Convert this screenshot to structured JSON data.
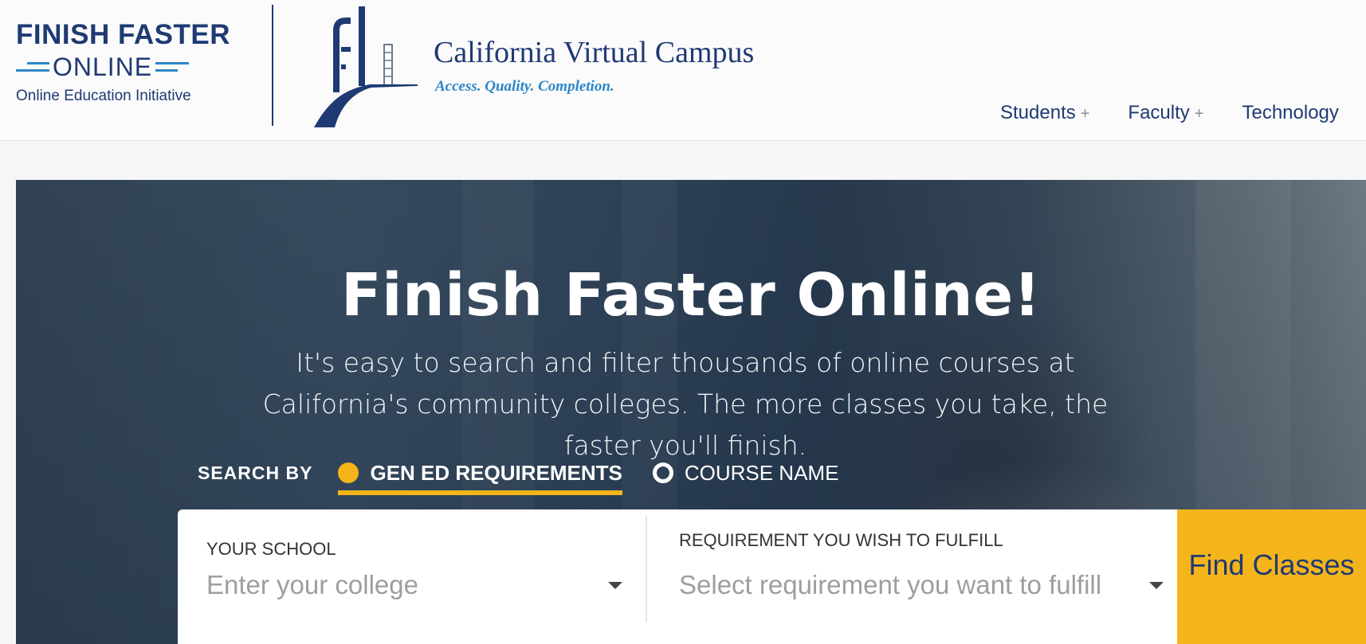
{
  "brand": {
    "ffo_line1": "FINISH FASTER",
    "ffo_line2": "ONLINE",
    "ffo_sub": "Online Education Initiative",
    "cvc_name": "California Virtual Campus",
    "cvc_tagline": "Access. Quality. Completion.",
    "colors": {
      "navy": "#1f3a73",
      "blue_accent": "#2c86c8",
      "gold": "#f4b41a"
    }
  },
  "nav": {
    "items": [
      {
        "label": "Students",
        "expand": "+"
      },
      {
        "label": "Faculty",
        "expand": "+"
      },
      {
        "label": "Technology"
      }
    ]
  },
  "hero": {
    "title": "Finish Faster Online!",
    "description": "It's easy to search and filter thousands of online courses at California's community colleges. The more classes you take, the faster you'll finish."
  },
  "search": {
    "by_label": "SEARCH BY",
    "options": [
      {
        "label": "GEN ED REQUIREMENTS",
        "selected": true
      },
      {
        "label": "COURSE NAME",
        "selected": false
      }
    ],
    "school_label": "YOUR SCHOOL",
    "school_placeholder": "Enter your college",
    "req_label": "REQUIREMENT YOU WISH TO FULFILL",
    "req_placeholder": "Select requirement you want to fulfill",
    "button_label": "Find Classes"
  }
}
